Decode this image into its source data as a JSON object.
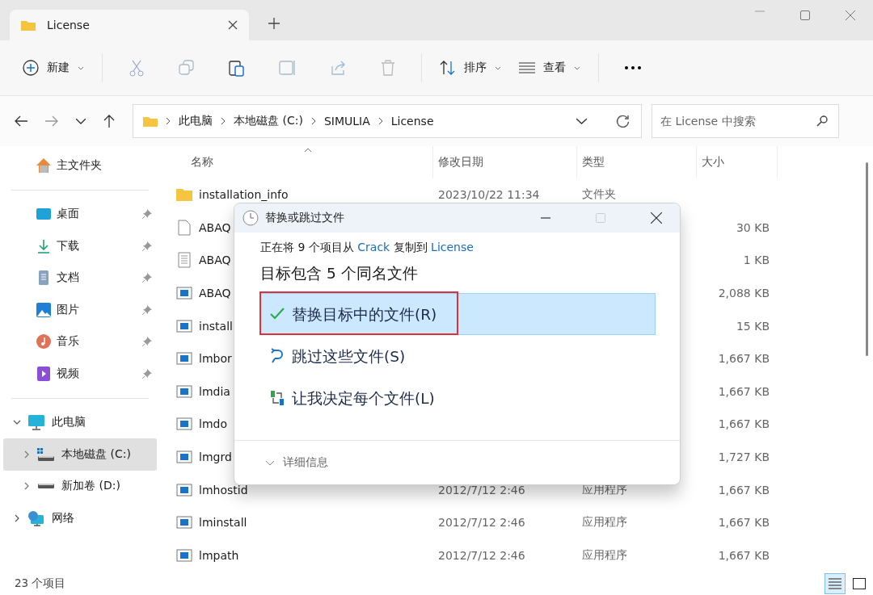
{
  "tabs": [
    {
      "label": "License",
      "selected": true
    }
  ],
  "toolbar": {
    "new_label": "新建",
    "sort_label": "排序",
    "view_label": "查看"
  },
  "breadcrumb": [
    "此电脑",
    "本地磁盘 (C:)",
    "SIMULIA",
    "License"
  ],
  "search": {
    "placeholder": "在 License 中搜索"
  },
  "sidebar": {
    "home": "主文件夹",
    "quick": [
      {
        "label": "桌面",
        "kind": "desktop"
      },
      {
        "label": "下载",
        "kind": "download"
      },
      {
        "label": "文档",
        "kind": "docs"
      },
      {
        "label": "图片",
        "kind": "pictures"
      },
      {
        "label": "音乐",
        "kind": "music"
      },
      {
        "label": "视频",
        "kind": "video"
      }
    ],
    "tree": [
      {
        "label": "此电脑",
        "kind": "pc",
        "expanded": true,
        "selected": false,
        "children": [
          {
            "label": "本地磁盘 (C:)",
            "kind": "sysdrive",
            "expanded": false,
            "selected": true
          },
          {
            "label": "新加卷 (D:)",
            "kind": "drive",
            "expanded": false,
            "selected": false
          }
        ]
      },
      {
        "label": "网络",
        "kind": "network",
        "expanded": false,
        "selected": false
      }
    ]
  },
  "table": {
    "columns": [
      "名称",
      "修改日期",
      "类型",
      "大小"
    ],
    "rows": [
      {
        "kind": "folder",
        "name": "installation_info",
        "date": "2023/10/22 11:34",
        "type": "文件夹"
      },
      {
        "kind": "file",
        "name": "ABAQ",
        "size": "30 KB"
      },
      {
        "kind": "text",
        "name": "ABAQ",
        "size": "1 KB"
      },
      {
        "kind": "app",
        "name": "ABAQ",
        "size": "2,088 KB"
      },
      {
        "kind": "app",
        "name": "install",
        "size": "15 KB"
      },
      {
        "kind": "app",
        "name": "lmbor",
        "size": "1,667 KB"
      },
      {
        "kind": "app",
        "name": "lmdia",
        "size": "1,667 KB"
      },
      {
        "kind": "app",
        "name": "lmdo",
        "size": "1,667 KB"
      },
      {
        "kind": "app",
        "name": "lmgrd",
        "size": "1,727 KB"
      },
      {
        "kind": "app",
        "name": "lmhostid",
        "date": "2012/7/12 2:46",
        "type": "应用程序",
        "size": "1,667 KB"
      },
      {
        "kind": "app",
        "name": "lminstall",
        "date": "2012/7/12 2:46",
        "type": "应用程序",
        "size": "1,667 KB"
      },
      {
        "kind": "app",
        "name": "lmpath",
        "date": "2012/7/12 2:46",
        "type": "应用程序",
        "size": "1,667 KB"
      }
    ]
  },
  "status_bar": {
    "count": "23 个项目"
  },
  "view_buttons": [
    {
      "kind": "details",
      "selected": true
    },
    {
      "kind": "tiles",
      "selected": false
    }
  ],
  "dialog": {
    "title": "替换或跳过文件",
    "message": {
      "prefix": "正在将 9 个项目从",
      "source": "Crack",
      "middle": "复制到",
      "target": "License"
    },
    "heading": "目标包含 5 个同名文件",
    "options": [
      {
        "kind": "replace",
        "label": "替换目标中的文件(R)",
        "selected": true,
        "highlighted": true
      },
      {
        "kind": "skip",
        "label": "跳过这些文件(S)",
        "selected": false,
        "highlighted": false
      },
      {
        "kind": "decide",
        "label": "让我决定每个文件(L)",
        "selected": false,
        "highlighted": false
      }
    ],
    "details": "详细信息"
  }
}
